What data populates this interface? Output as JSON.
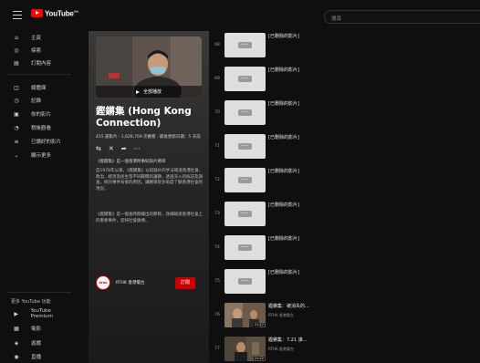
{
  "header": {
    "logo": "YouTube",
    "logo_sup": "HK",
    "search_placeholder": "搜尋"
  },
  "sidebar": {
    "primary": [
      {
        "icon": "home-icon",
        "glyph": "⌂",
        "label": "主頁"
      },
      {
        "icon": "explore-icon",
        "glyph": "◎",
        "label": "探索"
      },
      {
        "icon": "subscriptions-icon",
        "glyph": "▤",
        "label": "訂閱內容"
      }
    ],
    "library": [
      {
        "icon": "library-icon",
        "glyph": "◫",
        "label": "媒體庫"
      },
      {
        "icon": "history-icon",
        "glyph": "◷",
        "label": "記錄"
      },
      {
        "icon": "your-videos-icon",
        "glyph": "▣",
        "label": "你的影片"
      },
      {
        "icon": "watch-later-icon",
        "glyph": "◔",
        "label": "稍後觀看"
      },
      {
        "icon": "liked-icon",
        "glyph": "≡",
        "label": "已讚好的影片"
      },
      {
        "icon": "show-more-icon",
        "glyph": "⌄",
        "label": "顯示更多"
      }
    ],
    "more_title": "更多 YouTube 功能",
    "more": [
      {
        "icon": "premium-icon",
        "glyph": "▶",
        "label": "YouTube Premium"
      },
      {
        "icon": "movies-icon",
        "glyph": "▦",
        "label": "電影"
      },
      {
        "icon": "gaming-icon",
        "glyph": "◈",
        "label": "遊戲"
      },
      {
        "icon": "live-icon",
        "glyph": "◉",
        "label": "直播"
      }
    ]
  },
  "playlist": {
    "play_all": "全部播放",
    "title": "鏗鏘集 (Hong Kong Connection)",
    "meta": "415 部影片 · 1,628,769 次觀看 · 最後更新日期：5 天前",
    "actions": [
      "⇆",
      "✕",
      "➦",
      "⋯"
    ],
    "desc1": "《鏗鏘集》是一個香港時事紀錄片節目",
    "desc2": "自1978年以來，《鏗鏘集》以紀錄片的手法報道香港社會、政治、經濟及民生等不同範疇的議題，透過深入的採訪及調查，探討事件背後的原因，讓觀眾從多角度了解香港社會的現況。",
    "desc3": "《鏗鏘集》是一個長時間播出的節目，詳細報道香港社會上的重要事件，反映社會脈搏。",
    "channel_avatar": "RTHK",
    "channel_name": "RTHK 香港電台",
    "subscribe": "訂閱"
  },
  "videos": [
    {
      "index": "68",
      "title": "[已刪除的影片]",
      "sub": "",
      "deleted": true
    },
    {
      "index": "69",
      "title": "[已刪除的影片]",
      "sub": "",
      "deleted": true
    },
    {
      "index": "70",
      "title": "[已刪除的影片]",
      "sub": "",
      "deleted": true
    },
    {
      "index": "71",
      "title": "[已刪除的影片]",
      "sub": "",
      "deleted": true
    },
    {
      "index": "72",
      "title": "[已刪除的影片]",
      "sub": "",
      "deleted": true
    },
    {
      "index": "73",
      "title": "[已刪除的影片]",
      "sub": "",
      "deleted": true
    },
    {
      "index": "74",
      "title": "[已刪除的影片]",
      "sub": "",
      "deleted": true
    },
    {
      "index": "75",
      "title": "[已刪除的影片]",
      "sub": "",
      "deleted": true
    },
    {
      "index": "76",
      "title": "鏗鏘集：被消失的...",
      "sub": "RTHK 香港電台",
      "deleted": false,
      "duration": "21:27"
    },
    {
      "index": "77",
      "title": "鏗鏘集：7.21 誰...",
      "sub": "RTHK 香港電台",
      "deleted": false,
      "duration": "21:22"
    }
  ],
  "deleted_thumb_glyph": "•••"
}
